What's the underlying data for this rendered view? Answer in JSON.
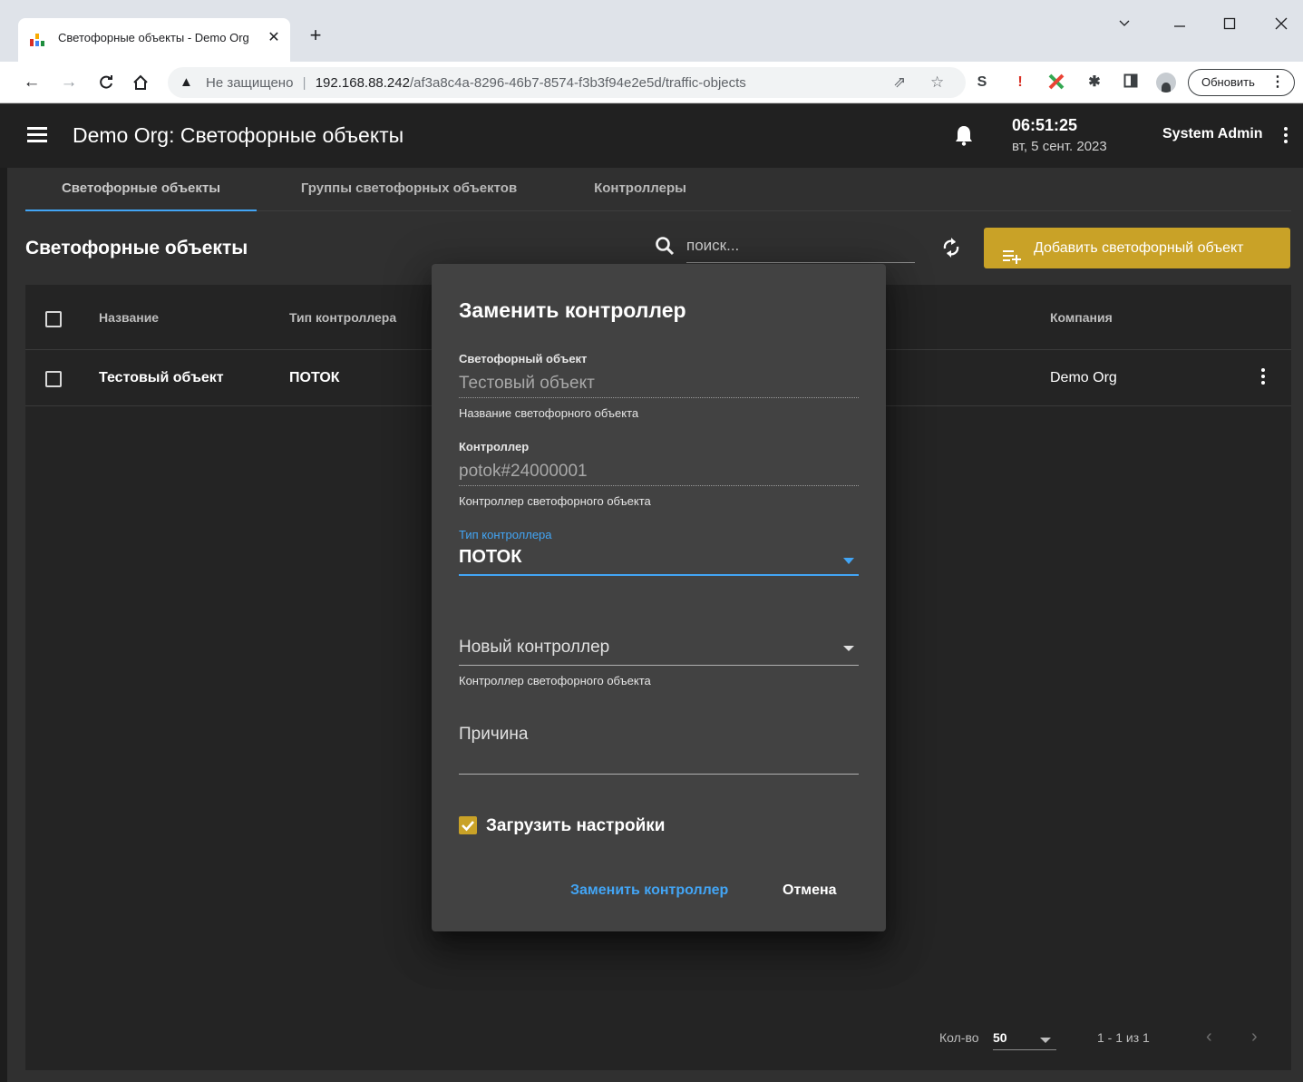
{
  "browser": {
    "tab_title": "Светофорные объекты - Demo Org",
    "tab_close": "✕",
    "new_tab": "+",
    "omnibox": {
      "security_label": "Не защищено",
      "separator": "|",
      "host": "192.168.88.242",
      "path": "/af3a8c4a-8296-46b7-8574-f3b3f94e2e5d/traffic-objects"
    },
    "update_button": "Обновить",
    "window_controls": [
      "chevron-down-icon",
      "minimize-icon",
      "maximize-icon",
      "close-icon"
    ]
  },
  "app": {
    "title": "Demo Org: Светофорные объекты",
    "time": "06:51:25",
    "date": "вт, 5 сент. 2023",
    "user": "System Admin"
  },
  "tabs": [
    {
      "label": "Светофорные объекты",
      "active": true
    },
    {
      "label": "Группы светофорных объектов",
      "active": false
    },
    {
      "label": "Контроллеры",
      "active": false
    }
  ],
  "page": {
    "section_title": "Светофорные объекты",
    "search_placeholder": "поиск...",
    "add_button": "Добавить светофорный объект",
    "accent_color": "#c9a227"
  },
  "table": {
    "headers": {
      "name": "Название",
      "controller_type": "Тип контроллера",
      "company": "Компания"
    },
    "rows": [
      {
        "name": "Тестовый объект",
        "controller_type": "ПОТОК",
        "company": "Demo Org"
      }
    ],
    "pager": {
      "per_page_label": "Кол-во",
      "per_page_value": "50",
      "range": "1 - 1 из 1"
    }
  },
  "dialog": {
    "title": "Заменить контроллер",
    "traffic_object": {
      "label": "Светофорный объект",
      "value": "Тестовый объект",
      "hint": "Название светофорного объекта"
    },
    "controller": {
      "label": "Контроллер",
      "value": "potok#24000001",
      "hint": "Контроллер светофорного объекта"
    },
    "controller_type": {
      "label": "Тип контроллера",
      "value": "ПОТОК"
    },
    "new_controller": {
      "placeholder": "Новый контроллер",
      "hint": "Контроллер светофорного объекта"
    },
    "reason": {
      "placeholder": "Причина"
    },
    "load_settings": {
      "label": "Загрузить настройки",
      "checked": true
    },
    "confirm_button": "Заменить контроллер",
    "cancel_button": "Отмена",
    "focus_color": "#42a5f5"
  }
}
